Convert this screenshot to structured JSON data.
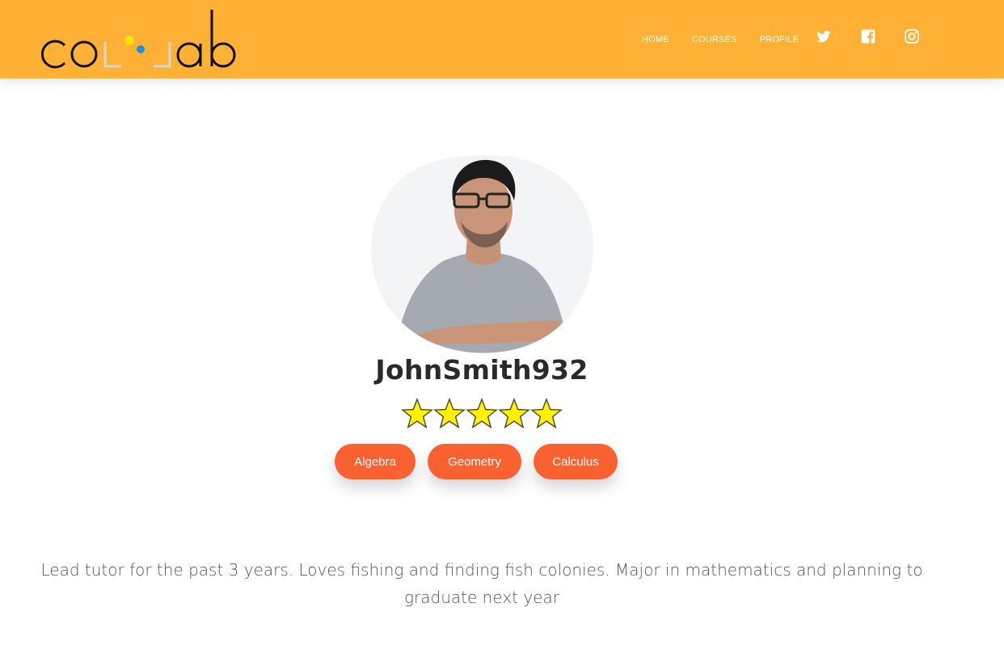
{
  "header": {
    "logo_text": "collab",
    "nav": [
      {
        "label": "HOME"
      },
      {
        "label": "COURSES"
      },
      {
        "label": "PROFILE"
      }
    ],
    "social": [
      "twitter-icon",
      "facebook-icon",
      "instagram-icon"
    ],
    "bg_color": "#ffb136"
  },
  "profile": {
    "username": "JohnSmith932",
    "rating": {
      "value": 5,
      "max": 5
    },
    "subjects": [
      "Algebra",
      "Geometry",
      "Calculus"
    ],
    "tag_color": "#fa6131",
    "bio": "Lead tutor for the past 3 years. Loves fishing and finding fish colonies. Major in mathematics and planning to graduate next year"
  }
}
